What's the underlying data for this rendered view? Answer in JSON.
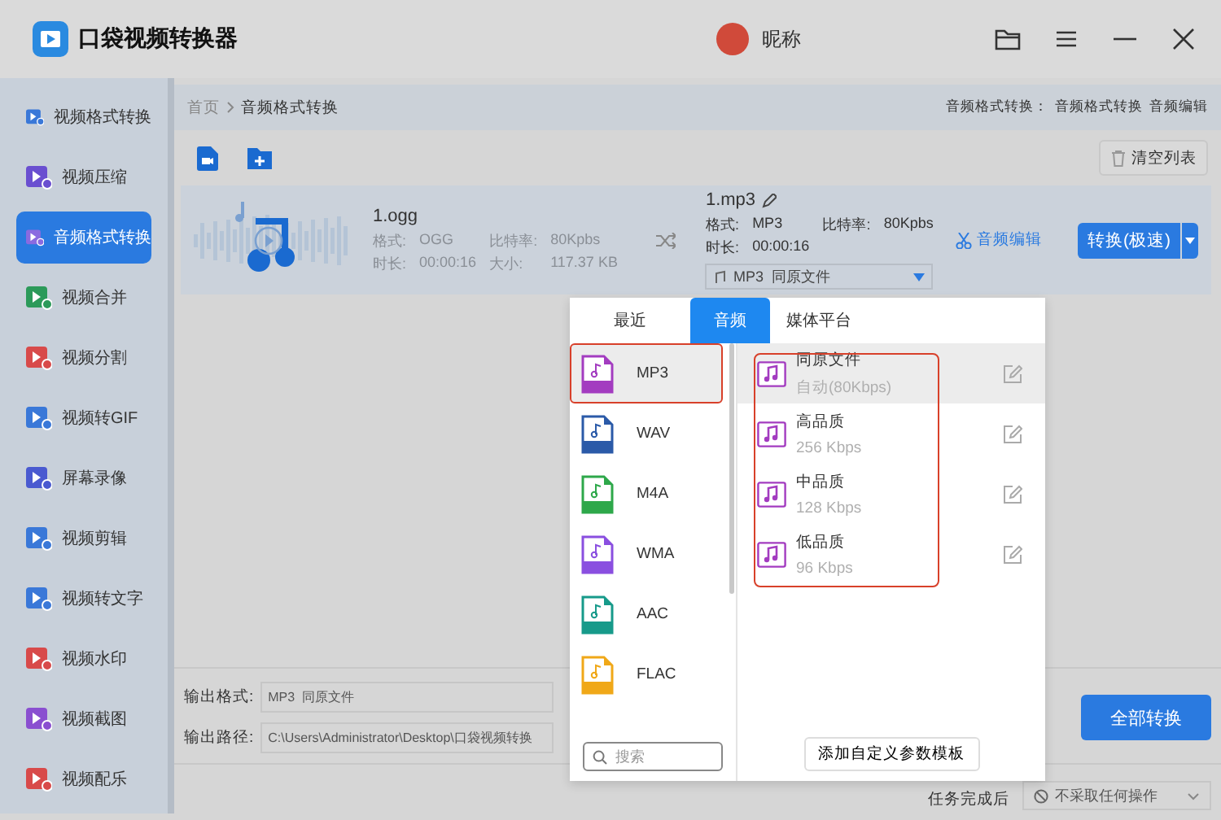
{
  "app": {
    "title": "口袋视频转换器",
    "user": "昵称"
  },
  "sidebar": {
    "items": [
      {
        "label": "视频格式转换",
        "color": "#3a78d8",
        "selected": false
      },
      {
        "label": "视频压缩",
        "color": "#6a4fd0",
        "selected": false
      },
      {
        "label": "音频格式转换",
        "color": "#8a6ae0",
        "selected": true
      },
      {
        "label": "视频合并",
        "color": "#2c9a5a",
        "selected": false
      },
      {
        "label": "视频分割",
        "color": "#d84a4a",
        "selected": false
      },
      {
        "label": "视频转GIF",
        "color": "#3a78d8",
        "selected": false
      },
      {
        "label": "屏幕录像",
        "color": "#4a5ad0",
        "selected": false
      },
      {
        "label": "视频剪辑",
        "color": "#3a78d8",
        "selected": false
      },
      {
        "label": "视频转文字",
        "color": "#3a78d8",
        "selected": false
      },
      {
        "label": "视频水印",
        "color": "#d84a4a",
        "selected": false
      },
      {
        "label": "视频截图",
        "color": "#8a4fd0",
        "selected": false
      },
      {
        "label": "视频配乐",
        "color": "#d84a4a",
        "selected": false
      }
    ]
  },
  "breadcrumb": {
    "home": "首页",
    "current": "音频格式转换",
    "links_label": "音频格式转换：",
    "links": [
      "音频格式转换",
      "音频编辑"
    ]
  },
  "toolbar": {
    "clear_button": "清空列表"
  },
  "file": {
    "source": {
      "name": "1.ogg",
      "format_label": "格式:",
      "format": "OGG",
      "bitrate_label": "比特率:",
      "bitrate": "80Kpbs",
      "duration_label": "时长:",
      "duration": "00:00:16",
      "size_label": "大小:",
      "size": "117.37 KB"
    },
    "target": {
      "name": "1.mp3",
      "format_label": "格式:",
      "format": "MP3",
      "bitrate_label": "比特率:",
      "bitrate": "80Kpbs",
      "duration_label": "时长:",
      "duration": "00:00:16",
      "preset": "MP3  同原文件"
    },
    "edit_link": "音频编辑",
    "convert_button": "转换(极速)"
  },
  "output": {
    "format_label": "输出格式:",
    "format": "MP3  同原文件",
    "path_label": "输出路径:",
    "path": "C:\\Users\\Administrator\\Desktop\\口袋视频转换"
  },
  "convert_all_button": "全部转换",
  "after_task": {
    "label": "任务完成后",
    "action": "不采取任何操作"
  },
  "format_popup": {
    "tabs": [
      {
        "label": "最近",
        "selected": false
      },
      {
        "label": "音频",
        "selected": true
      },
      {
        "label": "媒体平台",
        "selected": false
      }
    ],
    "formats": [
      {
        "label": "MP3",
        "color": "#a33cc0",
        "selected": true,
        "outlined": true
      },
      {
        "label": "WAV",
        "color": "#2b5aa8",
        "selected": false,
        "outlined": false
      },
      {
        "label": "M4A",
        "color": "#2ea84a",
        "selected": false,
        "outlined": false
      },
      {
        "label": "WMA",
        "color": "#8a4fe0",
        "selected": false,
        "outlined": false
      },
      {
        "label": "AAC",
        "color": "#179a8a",
        "selected": false,
        "outlined": false
      },
      {
        "label": "FLAC",
        "color": "#f0a818",
        "selected": false,
        "outlined": false
      }
    ],
    "presets_outlined": true,
    "presets": [
      {
        "name": "同原文件",
        "detail": "自动(80Kbps)",
        "selected": true
      },
      {
        "name": "高品质",
        "detail": "256 Kbps",
        "selected": false
      },
      {
        "name": "中品质",
        "detail": "128 Kbps",
        "selected": false
      },
      {
        "name": "低品质",
        "detail": "96 Kbps",
        "selected": false
      }
    ],
    "search_placeholder": "搜索",
    "add_button": "添加自定义参数模板"
  }
}
